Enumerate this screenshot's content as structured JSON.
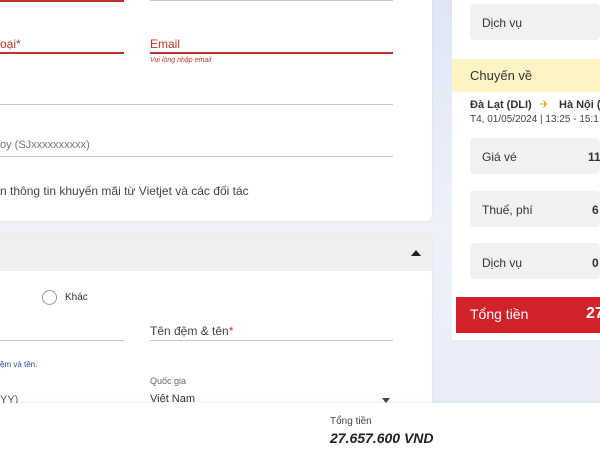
{
  "contact": {
    "phone_label": "oại",
    "email_label": "Email",
    "email_hint": "Vui lòng nhập email",
    "skyjoy_placeholder": "oy (SJxxxxxxxxxx)",
    "promo_text": "n thông tin khuyến mãi từ Vietjet và các đối tác"
  },
  "passenger": {
    "other_label": "Khác",
    "middle_first_label": "Tên đệm & tên",
    "name_hint": "ệm và tên.",
    "date_hint": "YY)",
    "country_label": "Quốc gia",
    "country_value": "Việt Nam"
  },
  "summary": {
    "service_label_top": "Dịch vụ",
    "return_flight_label": "Chuyến về",
    "route_from": "Đà Lạt (DLI)",
    "route_to": "Hà Nội (",
    "route_datetime": "T4, 01/05/2024 | 13:25 - 15:1",
    "fare_label": "Giá vé",
    "fare_value": "11",
    "tax_label": "Thuế, phí",
    "tax_value": "6",
    "service_label": "Dịch vụ",
    "service_value": "0",
    "total_label": "Tổng tiền",
    "total_value": "27"
  },
  "footer": {
    "total_label": "Tổng tiền",
    "total_value": "27.657.600 VND"
  },
  "colors": {
    "accent_red": "#d2232a",
    "summary_highlight": "#fdf3c4"
  }
}
